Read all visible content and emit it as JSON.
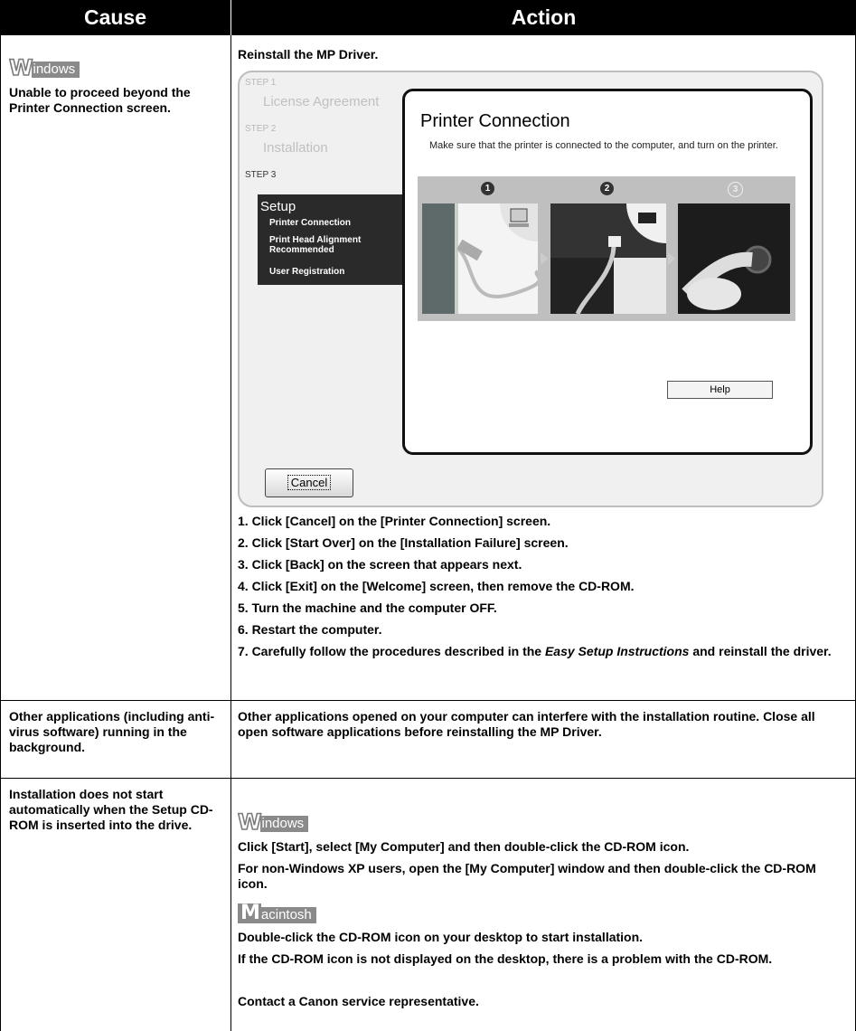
{
  "header": {
    "cause": "Cause",
    "action": "Action"
  },
  "os_labels": {
    "windows_big": "W",
    "windows_rest": "indows",
    "mac_big": "M",
    "mac_rest": "acintosh"
  },
  "row1": {
    "cause": "Unable to proceed beyond the Printer Connection screen.",
    "action_title": "Reinstall the MP Driver.",
    "screenshot": {
      "step1": "STEP 1",
      "step1_label": "License Agreement",
      "step2": "STEP 2",
      "step2_label": "Installation",
      "step3": "STEP 3",
      "setup_title": "Setup",
      "setup_items": [
        "Printer Connection",
        "Print Head Alignment Recommended",
        "User Registration"
      ],
      "dialog_title": "Printer Connection",
      "dialog_text": "Make sure that the printer is connected to the computer, and turn on the printer.",
      "numbers": [
        "1",
        "2",
        "3"
      ],
      "help_button": "Help",
      "cancel_button": "Cancel"
    },
    "steps": [
      "1. Click [Cancel] on the [Printer Connection] screen.",
      "2. Click [Start Over] on the [Installation Failure] screen.",
      "3. Click [Back] on the screen that appears next.",
      "4. Click [Exit] on the [Welcome] screen, then remove the CD-ROM.",
      "5. Turn the machine and the computer OFF.",
      "6. Restart the computer."
    ],
    "step7_a": "7. Carefully follow the procedures described in the ",
    "step7_italic": "Easy Setup Instructions",
    "step7_b": " and reinstall the driver."
  },
  "row2": {
    "cause": "Other applications (including anti-virus software) running in the background.",
    "action": "Other applications opened on your computer can interfere with the installation routine. Close all open software applications before reinstalling the MP Driver."
  },
  "row3": {
    "cause": "Installation does not start automatically when the Setup CD-ROM is inserted into the drive.",
    "windows_1": "Click [Start], select [My Computer] and then double-click the CD-ROM icon.",
    "windows_2": "For non-Windows XP users, open the [My Computer] window and then double-click the CD-ROM icon.",
    "mac_1": "Double-click the CD-ROM icon on your desktop to start installation.",
    "mac_2": "If the CD-ROM icon is not displayed on the desktop, there is a problem with the CD-ROM.",
    "mac_3": "Contact a Canon service representative."
  }
}
